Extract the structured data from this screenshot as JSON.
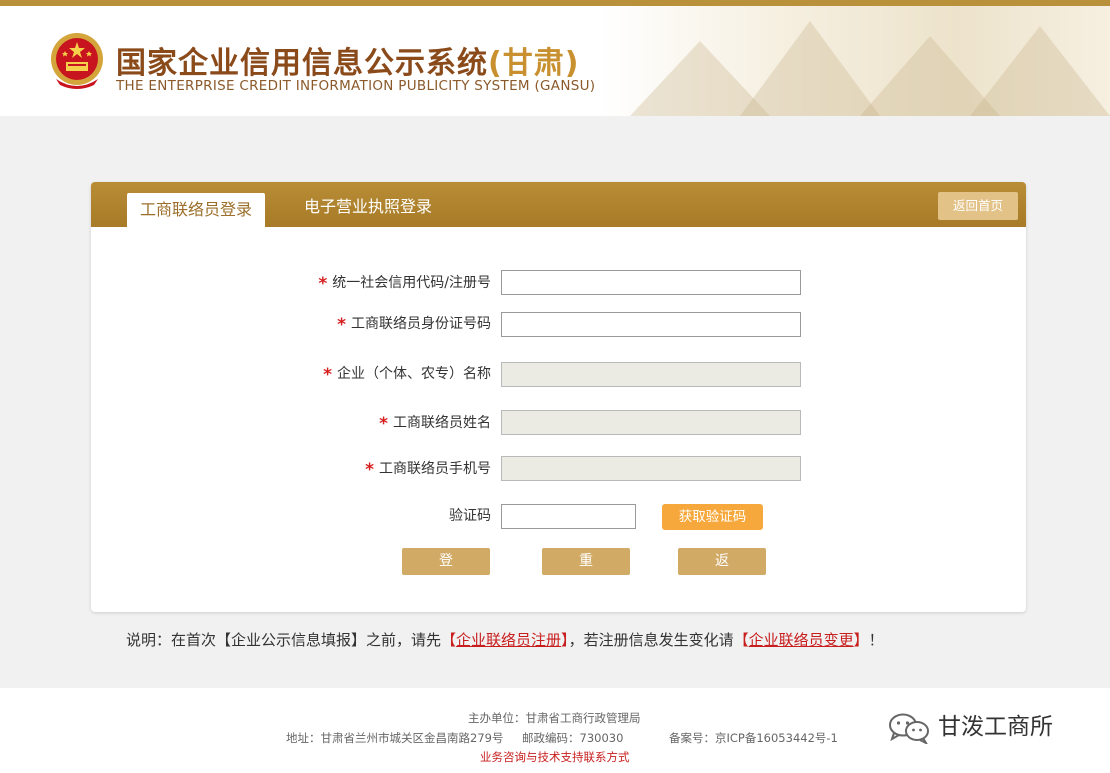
{
  "header": {
    "title_main": "国家企业信用信息公示系统",
    "title_region": "(甘肃)",
    "subtitle": "THE ENTERPRISE CREDIT INFORMATION PUBLICITY SYSTEM (GANSU)"
  },
  "tabs": [
    {
      "label": "工商联络员登录",
      "active": true
    },
    {
      "label": "电子营业执照登录",
      "active": false
    }
  ],
  "home_button": "返回首页",
  "form": {
    "fields": [
      {
        "label": "统一社会信用代码/注册号",
        "required": true,
        "disabled": false,
        "value": ""
      },
      {
        "label": "工商联络员身份证号码",
        "required": true,
        "disabled": false,
        "value": ""
      },
      {
        "label": "企业（个体、农专）名称",
        "required": true,
        "disabled": true,
        "value": ""
      },
      {
        "label": "工商联络员姓名",
        "required": true,
        "disabled": true,
        "value": ""
      },
      {
        "label": "工商联络员手机号",
        "required": true,
        "disabled": true,
        "value": ""
      }
    ],
    "captcha_label": "验证码",
    "captcha_value": "",
    "get_code_button": "获取验证码",
    "required_mark": "*"
  },
  "actions": {
    "login": "登录",
    "reset": "重置",
    "back": "返回"
  },
  "note": {
    "prefix": "说明：在首次【企业公示信息填报】之前，请先",
    "link1": "企业联络员注册",
    "middle": "，若注册信息发生变化请",
    "link2": "企业联络员变更",
    "suffix": "！",
    "bracket_open": "【",
    "bracket_close": "】"
  },
  "footer": {
    "sponsor": "主办单位：甘肃省工商行政管理局",
    "address": "地址：甘肃省兰州市城关区金昌南路279号",
    "postcode": "邮政编码：730030",
    "icp": "备案号：京ICP备16053442号-1",
    "support_link": "业务咨询与技术支持联系方式"
  },
  "watermark": {
    "name": "甘泼工商所"
  },
  "colors": {
    "brand_gold": "#b8913a",
    "title_brown": "#8a4a1a",
    "required_red": "#d62020",
    "sms_orange": "#f7a83c",
    "button_tan": "#d1aa65"
  }
}
